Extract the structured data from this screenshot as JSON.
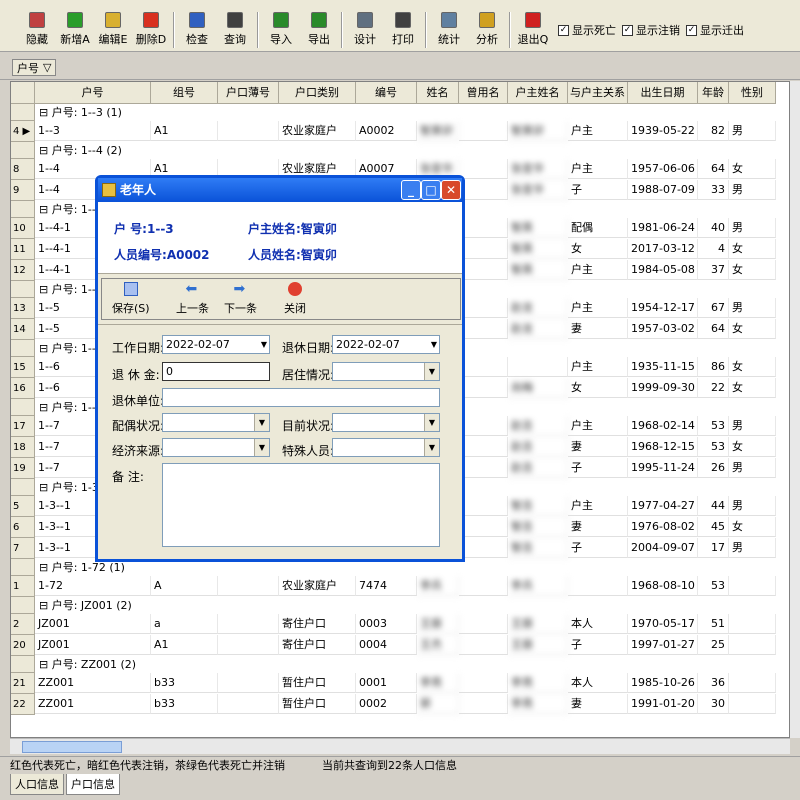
{
  "toolbar": {
    "buttons": [
      {
        "label": "隐藏",
        "icon": "hide-icon",
        "color": "#c04040"
      },
      {
        "label": "新增A",
        "icon": "add-icon",
        "color": "#2a9d2a"
      },
      {
        "label": "编辑E",
        "icon": "edit-icon",
        "color": "#d8b030"
      },
      {
        "label": "删除D",
        "icon": "delete-icon",
        "color": "#d83020"
      },
      {
        "label": "检查",
        "icon": "check-icon",
        "color": "#3060c0"
      },
      {
        "label": "查询",
        "icon": "binoculars-icon",
        "color": "#404040"
      },
      {
        "label": "导入",
        "icon": "import-icon",
        "color": "#2a8a2a"
      },
      {
        "label": "导出",
        "icon": "export-icon",
        "color": "#2a8a2a"
      },
      {
        "label": "设计",
        "icon": "design-icon",
        "color": "#607080"
      },
      {
        "label": "打印",
        "icon": "print-icon",
        "color": "#404040"
      },
      {
        "label": "统计",
        "icon": "stats-icon",
        "color": "#6080a0"
      },
      {
        "label": "分析",
        "icon": "analyze-icon",
        "color": "#d0a020"
      },
      {
        "label": "退出Q",
        "icon": "exit-icon",
        "color": "#d02020"
      }
    ],
    "checkboxes": [
      {
        "label": "显示死亡",
        "checked": "✓"
      },
      {
        "label": "显示注销",
        "checked": "✓"
      },
      {
        "label": "显示迁出",
        "checked": "✓"
      }
    ]
  },
  "groupbar": {
    "chip": "户号",
    "chip_icon": "filter-icon"
  },
  "grid": {
    "columns": [
      "户号",
      "组号",
      "户口薄号",
      "户口类别",
      "编号",
      "姓名",
      "曾用名",
      "户主姓名",
      "与户主关系",
      "出生日期",
      "年龄",
      "性别"
    ],
    "groups": [
      {
        "label": "户号: 1--3 (1)"
      },
      {
        "label": "户号: 1--4 (2)"
      },
      {
        "label": "户号: 1--"
      },
      {
        "label": "户号: 1--"
      },
      {
        "label": "户号: 1--"
      },
      {
        "label": "户号: 1--"
      },
      {
        "label": "户号: 1-3"
      },
      {
        "label": "户号: 1-72 (1)"
      },
      {
        "label": "户号: JZ001 (2)"
      },
      {
        "label": "户号: ZZ001 (2)"
      }
    ],
    "rows": [
      {
        "ind": "4 ▶",
        "huhao": "1--3",
        "zu": "A1",
        "bu": "",
        "lb": "农业家庭户",
        "bh": "A0002",
        "xm": "智寅卯",
        "cy": "",
        "hz": "智寅卯",
        "gx": "户主",
        "rq": "1939-05-22",
        "nl": "82",
        "xb": "男"
      },
      {
        "ind": "8",
        "huhao": "1--4",
        "zu": "A1",
        "bu": "",
        "lb": "农业家庭户",
        "bh": "A0007",
        "xm": "张变华",
        "cy": "",
        "hz": "张变华",
        "gx": "户主",
        "rq": "1957-06-06",
        "nl": "64",
        "xb": "女"
      },
      {
        "ind": "9",
        "huhao": "1--4",
        "zu": "",
        "bu": "",
        "lb": "",
        "bh": "",
        "xm": "",
        "cy": "",
        "hz": "张变华",
        "gx": "子",
        "rq": "1988-07-09",
        "nl": "33",
        "xb": "男"
      },
      {
        "ind": "10",
        "huhao": "1--4-1",
        "zu": "",
        "bu": "",
        "lb": "",
        "bh": "",
        "xm": "",
        "cy": "",
        "hz": "智英",
        "gx": "配偶",
        "rq": "1981-06-24",
        "nl": "40",
        "xb": "男"
      },
      {
        "ind": "11",
        "huhao": "1--4-1",
        "zu": "",
        "bu": "",
        "lb": "",
        "bh": "",
        "xm": "",
        "cy": "",
        "hz": "智英",
        "gx": "女",
        "rq": "2017-03-12",
        "nl": "4",
        "xb": "女"
      },
      {
        "ind": "12",
        "huhao": "1--4-1",
        "zu": "",
        "bu": "",
        "lb": "",
        "bh": "",
        "xm": "",
        "cy": "",
        "hz": "智英",
        "gx": "户主",
        "rq": "1984-05-08",
        "nl": "37",
        "xb": "女"
      },
      {
        "ind": "13",
        "huhao": "1--5",
        "zu": "",
        "bu": "",
        "lb": "",
        "bh": "",
        "xm": "",
        "cy": "",
        "hz": "赵龙",
        "gx": "户主",
        "rq": "1954-12-17",
        "nl": "67",
        "xb": "男"
      },
      {
        "ind": "14",
        "huhao": "1--5",
        "zu": "",
        "bu": "",
        "lb": "",
        "bh": "",
        "xm": "",
        "cy": "",
        "hz": "赵龙",
        "gx": "妻",
        "rq": "1957-03-02",
        "nl": "64",
        "xb": "女"
      },
      {
        "ind": "15",
        "huhao": "1--6",
        "zu": "",
        "bu": "",
        "lb": "",
        "bh": "",
        "xm": "",
        "cy": "",
        "hz": "",
        "gx": "户主",
        "rq": "1935-11-15",
        "nl": "86",
        "xb": "女"
      },
      {
        "ind": "16",
        "huhao": "1--6",
        "zu": "",
        "bu": "",
        "lb": "",
        "bh": "",
        "xm": "",
        "cy": "",
        "hz": "尚梅",
        "gx": "女",
        "rq": "1999-09-30",
        "nl": "22",
        "xb": "女"
      },
      {
        "ind": "17",
        "huhao": "1--7",
        "zu": "",
        "bu": "",
        "lb": "",
        "bh": "",
        "xm": "",
        "cy": "",
        "hz": "赵吉",
        "gx": "户主",
        "rq": "1968-02-14",
        "nl": "53",
        "xb": "男"
      },
      {
        "ind": "18",
        "huhao": "1--7",
        "zu": "",
        "bu": "",
        "lb": "",
        "bh": "",
        "xm": "",
        "cy": "",
        "hz": "赵吉",
        "gx": "妻",
        "rq": "1968-12-15",
        "nl": "53",
        "xb": "女"
      },
      {
        "ind": "19",
        "huhao": "1--7",
        "zu": "",
        "bu": "",
        "lb": "",
        "bh": "",
        "xm": "",
        "cy": "",
        "hz": "赵吉",
        "gx": "子",
        "rq": "1995-11-24",
        "nl": "26",
        "xb": "男"
      },
      {
        "ind": "5",
        "huhao": "1-3--1",
        "zu": "",
        "bu": "",
        "lb": "",
        "bh": "",
        "xm": "",
        "cy": "",
        "hz": "智吉",
        "gx": "户主",
        "rq": "1977-04-27",
        "nl": "44",
        "xb": "男"
      },
      {
        "ind": "6",
        "huhao": "1-3--1",
        "zu": "",
        "bu": "",
        "lb": "",
        "bh": "",
        "xm": "",
        "cy": "",
        "hz": "智吉",
        "gx": "妻",
        "rq": "1976-08-02",
        "nl": "45",
        "xb": "女"
      },
      {
        "ind": "7",
        "huhao": "1-3--1",
        "zu": "",
        "bu": "",
        "lb": "",
        "bh": "",
        "xm": "",
        "cy": "",
        "hz": "智吉",
        "gx": "子",
        "rq": "2004-09-07",
        "nl": "17",
        "xb": "男"
      },
      {
        "ind": "1",
        "huhao": "1-72",
        "zu": "A",
        "bu": "",
        "lb": "农业家庭户",
        "bh": "7474",
        "xm": "李兵",
        "cy": "",
        "hz": "李兵",
        "gx": "",
        "rq": "1968-08-10",
        "nl": "53",
        "xb": ""
      },
      {
        "ind": "2",
        "huhao": "JZ001",
        "zu": "a",
        "bu": "",
        "lb": "寄住户口",
        "bh": "0003",
        "xm": "王振",
        "cy": "",
        "hz": "王振",
        "gx": "本人",
        "rq": "1970-05-17",
        "nl": "51",
        "xb": ""
      },
      {
        "ind": "20",
        "huhao": "JZ001",
        "zu": "A1",
        "bu": "",
        "lb": "寄住户口",
        "bh": "0004",
        "xm": "王杰",
        "cy": "",
        "hz": "王振",
        "gx": "子",
        "rq": "1997-01-27",
        "nl": "25",
        "xb": ""
      },
      {
        "ind": "21",
        "huhao": "ZZ001",
        "zu": "b33",
        "bu": "",
        "lb": "暂住户口",
        "bh": "0001",
        "xm": "李亮",
        "cy": "",
        "hz": "李亮",
        "gx": "本人",
        "rq": "1985-10-26",
        "nl": "36",
        "xb": ""
      },
      {
        "ind": "22",
        "huhao": "ZZ001",
        "zu": "b33",
        "bu": "",
        "lb": "暂住户口",
        "bh": "0002",
        "xm": "郭",
        "cy": "",
        "hz": "李亮",
        "gx": "妻",
        "rq": "1991-01-20",
        "nl": "30",
        "xb": ""
      }
    ]
  },
  "status": {
    "left": "红色代表死亡，暗红色代表注销，茶绿色代表死亡并注销",
    "right": "当前共查询到22条人口信息"
  },
  "tabs": [
    "人口信息",
    "户口信息"
  ],
  "dialog": {
    "title": "老年人",
    "huhao_label": "户    号:",
    "huhao_value": "1--3",
    "hz_label": "户主姓名:",
    "hz_value": "智寅卯",
    "rybh_label": "人员编号:",
    "rybh_value": "A0002",
    "ryxm_label": "人员姓名:",
    "ryxm_value": "智寅卯",
    "buttons": [
      {
        "label": "保存(S)",
        "icon": "save-icon"
      },
      {
        "label": "上一条",
        "icon": "arrow-left-icon"
      },
      {
        "label": "下一条",
        "icon": "arrow-right-icon"
      },
      {
        "label": "关闭",
        "icon": "close-icon"
      }
    ],
    "form": {
      "work_date_label": "工作日期:",
      "work_date": "2022-02-07",
      "retire_date_label": "退休日期:",
      "retire_date": "2022-02-07",
      "pension_label": "退 休 金:",
      "pension": "0",
      "living_label": "居住情况:",
      "living": "",
      "unit_label": "退休单位:",
      "unit": "",
      "spouse_label": "配偶状况:",
      "spouse": "",
      "current_label": "目前状况:",
      "current": "",
      "income_label": "经济来源:",
      "income": "",
      "special_label": "特殊人员:",
      "special": "",
      "remark_label": "备    注:",
      "remark": ""
    }
  }
}
